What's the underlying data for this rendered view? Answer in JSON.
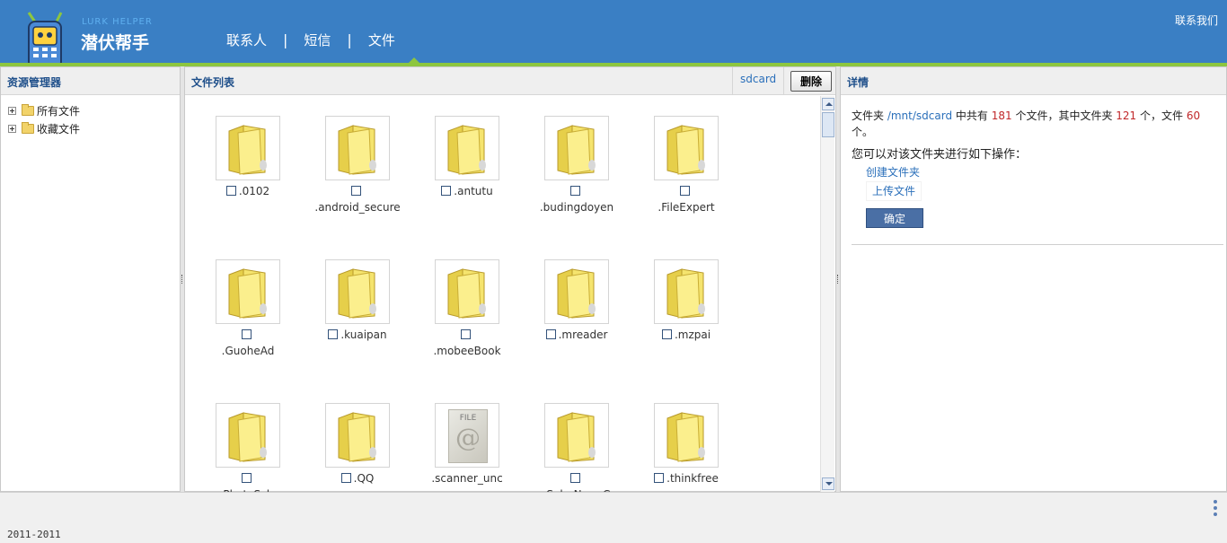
{
  "app": {
    "logo_sub": "LURK HELPER",
    "logo_title": "潜伏帮手",
    "contact": "联系我们"
  },
  "nav": {
    "items": [
      {
        "label": "联系人",
        "active": false
      },
      {
        "label": "短信",
        "active": false
      },
      {
        "label": "文件",
        "active": true
      }
    ],
    "separator": "|"
  },
  "left_panel": {
    "title": "资源管理器",
    "tree": [
      {
        "label": "所有文件"
      },
      {
        "label": "收藏文件"
      }
    ]
  },
  "mid_panel": {
    "title": "文件列表",
    "location": "sdcard",
    "delete_label": "删除",
    "files": [
      {
        "name": ".0102",
        "type": "folder",
        "inline": true
      },
      {
        "name": ".android_secure",
        "type": "folder",
        "inline": false
      },
      {
        "name": ".antutu",
        "type": "folder",
        "inline": true
      },
      {
        "name": ".budingdoyen",
        "type": "folder",
        "inline": false
      },
      {
        "name": ".FileExpert",
        "type": "folder",
        "inline": false
      },
      {
        "name": ".GuoheAd",
        "type": "folder",
        "inline": false
      },
      {
        "name": ".kuaipan",
        "type": "folder",
        "inline": true
      },
      {
        "name": ".mobeeBook",
        "type": "folder",
        "inline": false
      },
      {
        "name": ".mreader",
        "type": "folder",
        "inline": true
      },
      {
        "name": ".mzpai",
        "type": "folder",
        "inline": true
      },
      {
        "name": ".PhotoScla",
        "type": "folder",
        "inline": false
      },
      {
        "name": ".QQ",
        "type": "folder",
        "inline": true
      },
      {
        "name": ".scanner_unc",
        "type": "file",
        "inline": true,
        "no_checkbox": true
      },
      {
        "name": ".SohuNewsC",
        "type": "folder",
        "inline": false
      },
      {
        "name": ".thinkfree",
        "type": "folder",
        "inline": true
      }
    ],
    "file_thumb_label": "FILE"
  },
  "right_panel": {
    "title": "详情",
    "summary": {
      "prefix": "文件夹 ",
      "path": "/mnt/sdcard",
      "mid1": " 中共有 ",
      "total": "181",
      "mid2": " 个文件，其中文件夹 ",
      "folders": "121",
      "mid3": " 个，文件 ",
      "files": "60",
      "suffix": " 个。"
    },
    "ops_title": "您可以对该文件夹进行如下操作：",
    "ops": [
      "创建文件夹",
      "上传文件"
    ],
    "confirm_label": "确定"
  },
  "footer": {
    "copyright": "2011-2011"
  },
  "colors": {
    "header": "#3a7fc4",
    "accent_stripe": "#8dc63f",
    "link": "#2a6fba",
    "highlight_num": "#c0282a"
  }
}
